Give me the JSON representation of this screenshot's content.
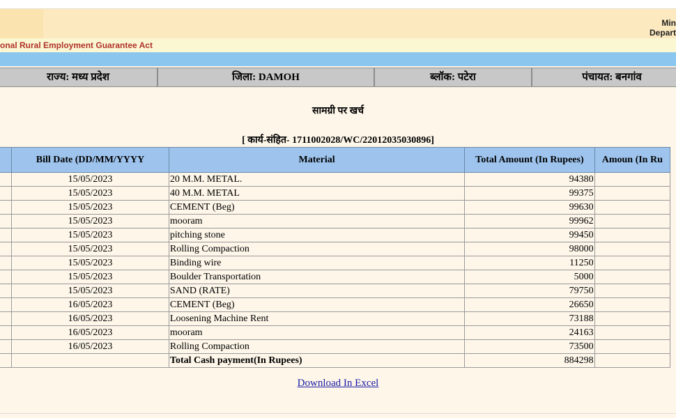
{
  "header": {
    "ministry_line1": "Min",
    "ministry_line2": "Depart",
    "act_title": "onal Rural Employment Guarantee Act"
  },
  "location": {
    "state": "राज्य: मध्य प्रदेश",
    "district": "जिला: DAMOH",
    "block": "ब्लॉक: पटेरा",
    "panchayat": "पंचायत: बनगांव"
  },
  "page_title": "सामग्री पर खर्च",
  "work_code": "[ कार्य-संहित- 1711002028/WC/22012035030896]",
  "table": {
    "headers": {
      "bill_date": "Bill Date (DD/MM/YYYY",
      "material": "Material",
      "total_amount": "Total Amount (In Rupees)",
      "amount": "Amoun (In Ru"
    },
    "rows": [
      {
        "date": "15/05/2023",
        "material": "20 M.M. METAL.",
        "amount": "94380"
      },
      {
        "date": "15/05/2023",
        "material": "40 M.M. METAL",
        "amount": "99375"
      },
      {
        "date": "15/05/2023",
        "material": "CEMENT (Beg)",
        "amount": "99630"
      },
      {
        "date": "15/05/2023",
        "material": "mooram",
        "amount": "99962"
      },
      {
        "date": "15/05/2023",
        "material": "pitching stone",
        "amount": "99450"
      },
      {
        "date": "15/05/2023",
        "material": "Rolling Compaction",
        "amount": "98000"
      },
      {
        "date": "15/05/2023",
        "material": "Binding wire",
        "amount": "11250"
      },
      {
        "date": "15/05/2023",
        "material": "Boulder Transportation",
        "amount": "5000"
      },
      {
        "date": "15/05/2023",
        "material": "SAND (RATE)",
        "amount": "79750"
      },
      {
        "date": "16/05/2023",
        "material": "CEMENT (Beg)",
        "amount": "26650"
      },
      {
        "date": "16/05/2023",
        "material": "Loosening Machine Rent",
        "amount": "73188"
      },
      {
        "date": "16/05/2023",
        "material": "mooram",
        "amount": "24163"
      },
      {
        "date": "16/05/2023",
        "material": "Rolling Compaction",
        "amount": "73500"
      }
    ],
    "total": {
      "label": "Total Cash payment(In Rupees)",
      "amount": "884298"
    }
  },
  "download_link": "Download In Excel",
  "colors": {
    "banner": "#fde9bf",
    "act_bar": "#fbf7d2",
    "act_text": "#b0322a",
    "blue_bar": "#8bc6ef",
    "header_cells": "#9ec4ee",
    "location_cells": "#c8c8c8",
    "page_bg": "#fdf6e9",
    "link": "#1a1aa8"
  }
}
